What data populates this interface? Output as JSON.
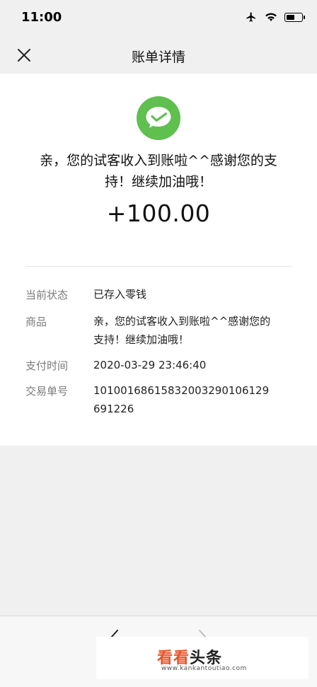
{
  "status_bar": {
    "time": "11:00"
  },
  "nav": {
    "title": "账单详情"
  },
  "headline": {
    "line1": "亲，您的试客收入到账啦^^感谢您的支",
    "line2": "持！继续加油哦！"
  },
  "amount": "+100.00",
  "details": {
    "status": {
      "label": "当前状态",
      "value": "已存入零钱"
    },
    "product": {
      "label": "商品",
      "value_line1": "亲，您的试客收入到账啦^^感谢您的",
      "value_line2": "支持！继续加油哦！"
    },
    "pay_time": {
      "label": "支付时间",
      "value": "2020-03-29 23:46:40"
    },
    "order_no": {
      "label": "交易单号",
      "value_line1": "1010016861583200329010612​9",
      "value_line2": "691226"
    }
  },
  "watermark": {
    "brand_kan": "看看",
    "brand_tou": "头条",
    "url": "www.kankantoutiao.com"
  },
  "colors": {
    "wechat_green": "#5fbf4f",
    "page_bg": "#f0f0f0"
  }
}
